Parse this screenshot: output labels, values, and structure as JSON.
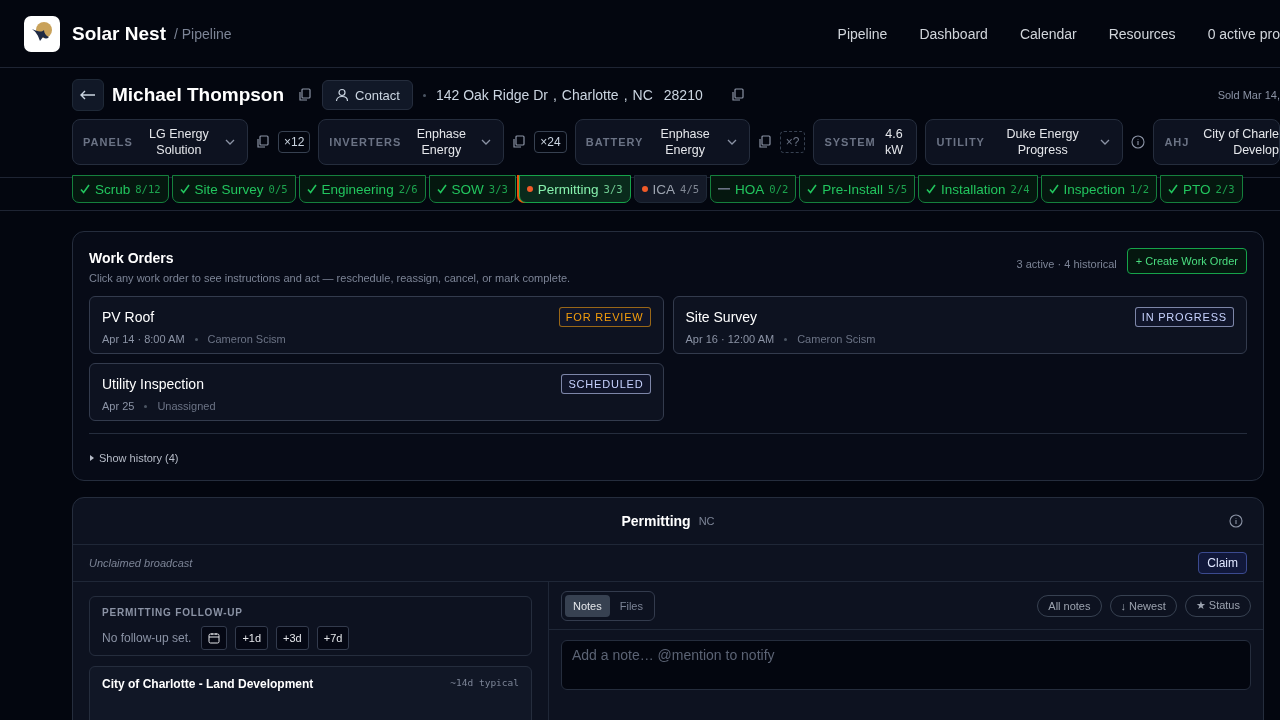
{
  "header": {
    "brand": "Solar Nest",
    "breadcrumb": "/ Pipeline",
    "nav": [
      "Pipeline",
      "Dashboard",
      "Calendar",
      "Resources",
      "0 active pro"
    ]
  },
  "customer": {
    "name": "Michael Thompson",
    "contact": "Contact",
    "address": [
      "142 Oak Ridge Dr",
      ",",
      "Charlotte",
      ",",
      "NC",
      "28210"
    ],
    "sold": "Sold Mar 14,"
  },
  "equipment": [
    {
      "kind": "select",
      "label": "PANELS",
      "value_lines": [
        "LG Energy",
        "Solution"
      ],
      "qty": "×12",
      "qty_known": true
    },
    {
      "kind": "select",
      "label": "INVERTERS",
      "value_lines": [
        "Enphase",
        "Energy"
      ],
      "qty": "×24",
      "qty_known": true
    },
    {
      "kind": "select",
      "label": "BATTERY",
      "value_lines": [
        "Enphase",
        "Energy"
      ],
      "qty": "×?",
      "qty_known": false
    },
    {
      "kind": "static",
      "label": "SYSTEM",
      "value_lines": [
        "4.6",
        "kW"
      ]
    },
    {
      "kind": "select",
      "label": "UTILITY",
      "value_lines": [
        "Duke Energy",
        "Progress"
      ],
      "info": true
    },
    {
      "kind": "cut",
      "label": "AHJ",
      "value_lines": [
        "City of Charle",
        "Develop"
      ]
    }
  ],
  "stages": [
    {
      "name": "Scrub",
      "count": "8/12",
      "kind": "done",
      "selected": false
    },
    {
      "name": "Site Survey",
      "count": "0/5",
      "kind": "done",
      "selected": false
    },
    {
      "name": "Engineering",
      "count": "2/6",
      "kind": "done",
      "selected": false
    },
    {
      "name": "SOW",
      "count": "3/3",
      "kind": "done",
      "selected": false
    },
    {
      "name": "Permitting",
      "count": "3/3",
      "kind": "current",
      "selected": true
    },
    {
      "name": "ICA",
      "count": "4/5",
      "kind": "blocked",
      "selected": false
    },
    {
      "name": "HOA",
      "count": "0/2",
      "kind": "skipped",
      "selected": false
    },
    {
      "name": "Pre-Install",
      "count": "5/5",
      "kind": "done",
      "selected": false
    },
    {
      "name": "Installation",
      "count": "2/4",
      "kind": "done",
      "selected": false
    },
    {
      "name": "Inspection",
      "count": "1/2",
      "kind": "done",
      "selected": false
    },
    {
      "name": "PTO",
      "count": "2/3",
      "kind": "done",
      "selected": false
    }
  ],
  "work_orders": {
    "title": "Work Orders",
    "subtitle": "Click any work order to see instructions and act — reschedule, reassign, cancel, or mark complete.",
    "summary": "3 active · 4 historical",
    "create": "+ Create Work Order",
    "items": [
      {
        "title": "PV Roof",
        "status": "FOR REVIEW",
        "color": "#f59e0b",
        "when": "Apr 14 · 8:00 AM",
        "assignee": "Cameron Scism"
      },
      {
        "title": "Site Survey",
        "status": "IN PROGRESS",
        "color": "#c7d2fe",
        "when": "Apr 16 · 12:00 AM",
        "assignee": "Cameron Scism"
      },
      {
        "title": "Utility Inspection",
        "status": "SCHEDULED",
        "color": "#c7d2fe",
        "when": "Apr 25",
        "assignee": "Unassigned"
      }
    ],
    "history": "Show history (4)",
    "history_expanded": false
  },
  "permitting": {
    "title": "Permitting",
    "state": "NC",
    "broadcast": "Unclaimed broadcast",
    "claim": "Claim",
    "follow_up": {
      "label": "PERMITTING FOLLOW-UP",
      "text": "No follow-up set.",
      "quick": [
        "+1d",
        "+3d",
        "+7d"
      ]
    },
    "permit": {
      "name": "City of Charlotte - Land Development",
      "typical": "~14d typical"
    },
    "tabs": [
      {
        "label": "Notes",
        "selected": true
      },
      {
        "label": "Files",
        "selected": false
      }
    ],
    "filters": [
      "All notes",
      "↓ Newest",
      "★ Status"
    ],
    "note": {
      "placeholder": "Add a note… @mention to notify"
    }
  }
}
